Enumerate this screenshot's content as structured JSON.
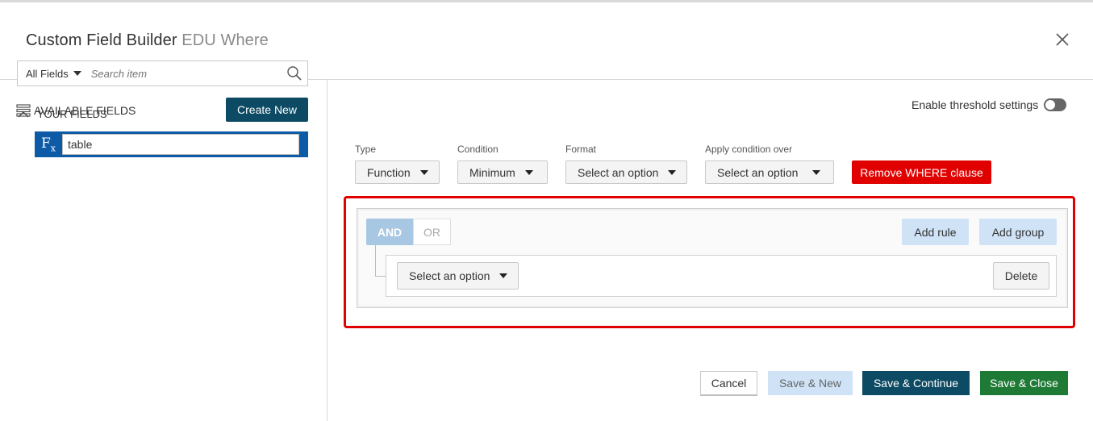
{
  "dialog": {
    "title": "Custom Field Builder",
    "subtitle": "EDU Where"
  },
  "sidebar": {
    "section_title": "AVAILABLE FIELDS",
    "create_button": "Create New",
    "filter_selected": "All Fields",
    "search_placeholder": "Search item",
    "your_fields_title": "YOUR FIELDS",
    "fields": [
      {
        "name": "table",
        "icon": "function-icon"
      }
    ]
  },
  "threshold": {
    "label": "Enable threshold settings",
    "enabled": false
  },
  "condition_bar": {
    "type_label": "Type",
    "type_value": "Function",
    "condition_label": "Condition",
    "condition_value": "Minimum",
    "format_label": "Format",
    "format_value": "Select an option",
    "apply_label": "Apply condition over",
    "apply_value": "Select an option",
    "remove_button": "Remove WHERE clause"
  },
  "query_builder": {
    "and_label": "AND",
    "or_label": "OR",
    "active_conjunction": "AND",
    "add_rule": "Add rule",
    "add_group": "Add group",
    "rule_select_value": "Select an option",
    "delete_button": "Delete"
  },
  "footer": {
    "cancel": "Cancel",
    "save_new": "Save & New",
    "save_continue": "Save & Continue",
    "save_close": "Save & Close"
  },
  "colors": {
    "primary_dark": "#0d4a63",
    "danger": "#e00000",
    "success": "#1e7a35",
    "light_blue": "#cfe2f6",
    "selected_blue": "#0d5aa7"
  }
}
